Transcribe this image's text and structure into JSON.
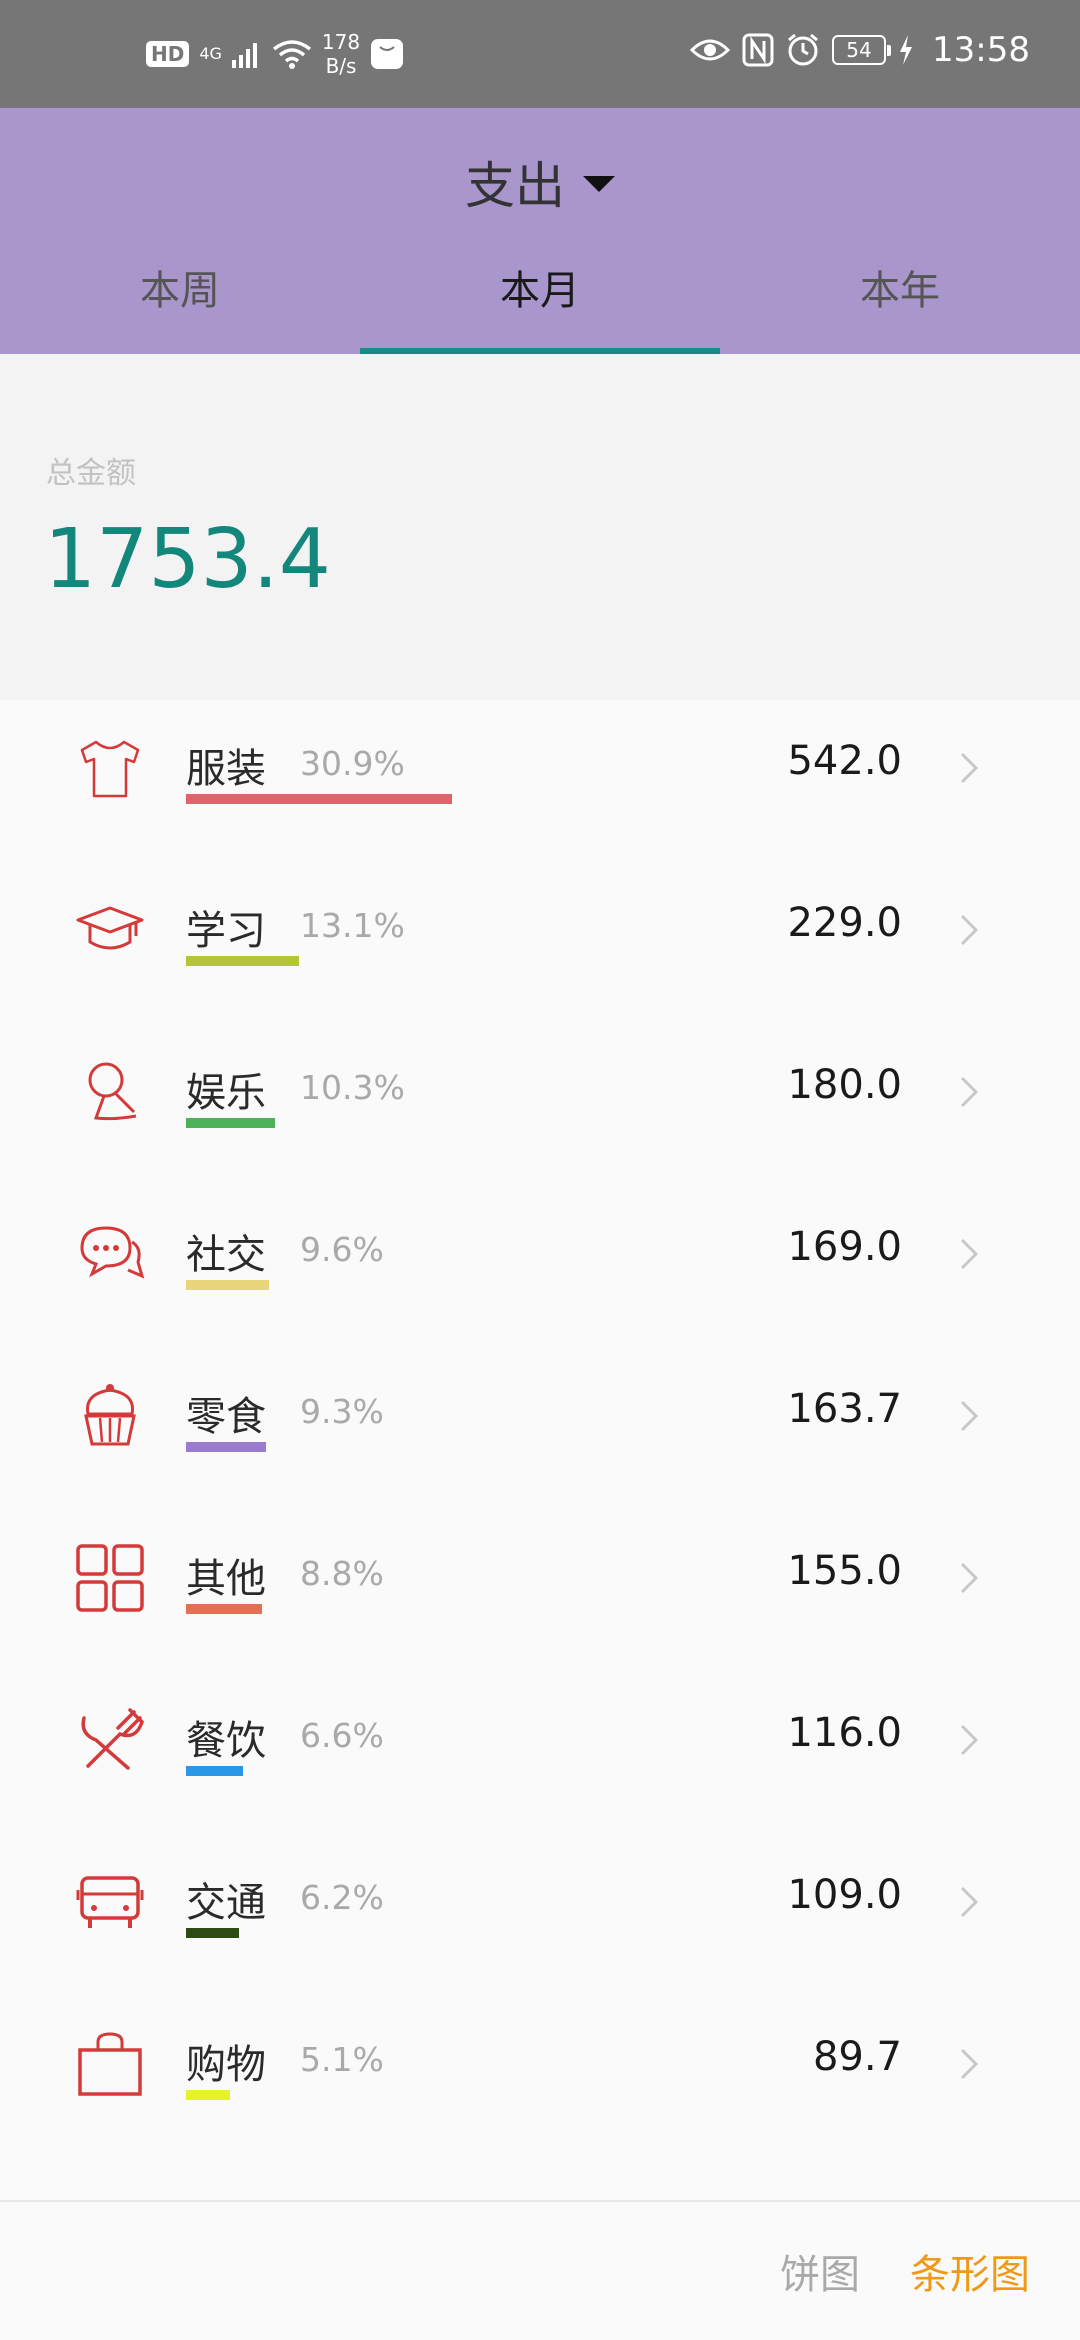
{
  "status_bar": {
    "hd": "HD",
    "network": "4G",
    "speed_value": "178",
    "speed_unit": "B/s",
    "battery": "54",
    "time": "13:58"
  },
  "header": {
    "type": "支出",
    "tabs": [
      "本周",
      "本月",
      "本年"
    ],
    "active_tab": "本月"
  },
  "summary": {
    "label": "总金额",
    "amount": "1753.4"
  },
  "categories": [
    {
      "name": "服装",
      "pct": "30.9%",
      "value": "542.0",
      "share": 0.309,
      "color": "#e0636b",
      "icon": "tshirt-icon"
    },
    {
      "name": "学习",
      "pct": "13.1%",
      "value": "229.0",
      "share": 0.131,
      "color": "#b5c53a",
      "icon": "graduation-cap-icon"
    },
    {
      "name": "娱乐",
      "pct": "10.3%",
      "value": "180.0",
      "share": 0.103,
      "color": "#4fb05a",
      "icon": "microphone-icon"
    },
    {
      "name": "社交",
      "pct": "9.6%",
      "value": "169.0",
      "share": 0.096,
      "color": "#e8d57a",
      "icon": "chat-bubbles-icon"
    },
    {
      "name": "零食",
      "pct": "9.3%",
      "value": "163.7",
      "share": 0.093,
      "color": "#9a7bd0",
      "icon": "cupcake-icon"
    },
    {
      "name": "其他",
      "pct": "8.8%",
      "value": "155.0",
      "share": 0.088,
      "color": "#e07155",
      "icon": "grid-icon"
    },
    {
      "name": "餐饮",
      "pct": "6.6%",
      "value": "116.0",
      "share": 0.066,
      "color": "#2b95e6",
      "icon": "fork-knife-icon"
    },
    {
      "name": "交通",
      "pct": "6.2%",
      "value": "109.0",
      "share": 0.062,
      "color": "#2f4a14",
      "icon": "bus-icon"
    },
    {
      "name": "购物",
      "pct": "5.1%",
      "value": "89.7",
      "share": 0.051,
      "color": "#e6f22a",
      "icon": "shopping-bag-icon"
    }
  ],
  "footer": {
    "pie_label": "饼图",
    "bar_label": "条形图",
    "active": "条形图"
  }
}
